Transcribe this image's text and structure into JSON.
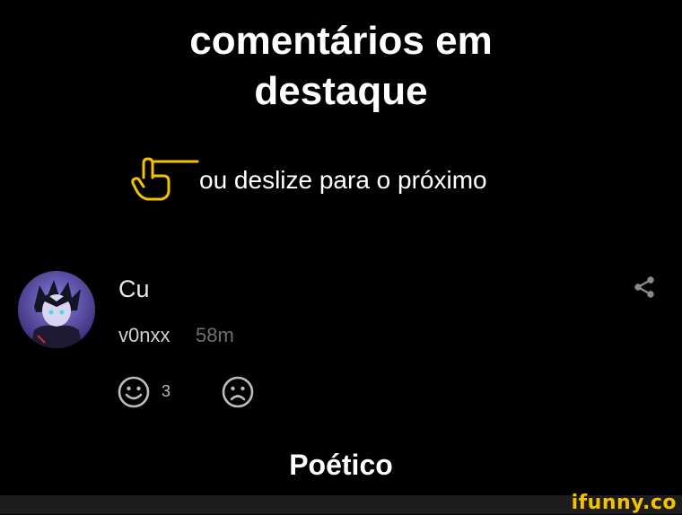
{
  "header": {
    "title_line1": "comentários em",
    "title_line2": "destaque"
  },
  "swipe": {
    "icon": "swipe-hand-icon",
    "text": "ou deslize para o próximo",
    "accent_color": "#f2c200"
  },
  "comment": {
    "text": "Cu",
    "username": "v0nxx",
    "time_ago": "58m",
    "likes": "3",
    "avatar_icon": "user-avatar"
  },
  "caption": "Poético",
  "watermark": "ifunny.co"
}
